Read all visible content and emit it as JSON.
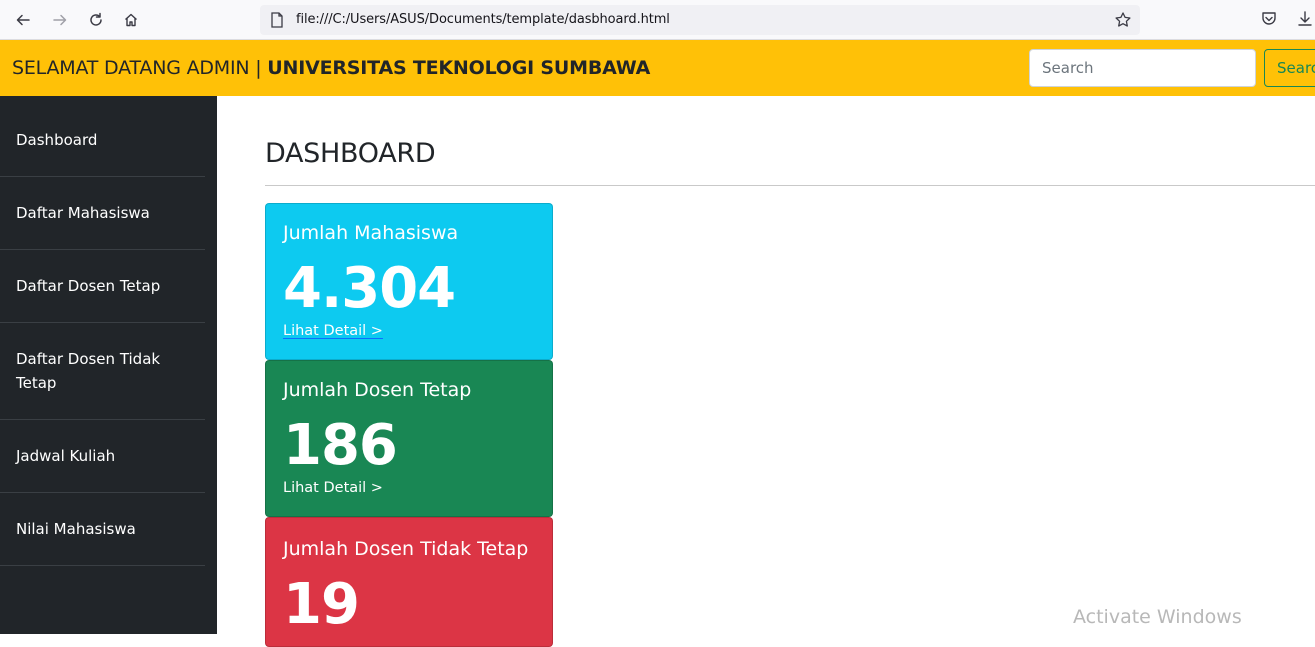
{
  "browser": {
    "url": "file:///C:/Users/ASUS/Documents/template/dasbhoard.html"
  },
  "navbar": {
    "brand_prefix": "SELAMAT DATANG ADMIN | ",
    "brand_bold": "UNIVERSITAS TEKNOLOGI SUMBAWA",
    "search_placeholder": "Search",
    "search_button": "Search",
    "background": "#ffc107"
  },
  "sidebar": {
    "items": [
      {
        "label": "Dashboard"
      },
      {
        "label": "Daftar Mahasiswa"
      },
      {
        "label": "Daftar Dosen Tetap"
      },
      {
        "label": "Daftar Dosen Tidak Tetap"
      },
      {
        "label": "Jadwal Kuliah"
      },
      {
        "label": "Nilai Mahasiswa"
      }
    ]
  },
  "main": {
    "title": "DASHBOARD",
    "cards": [
      {
        "title": "Jumlah Mahasiswa",
        "value": "4.304",
        "link": "Lihat Detail >",
        "color": "#0dcaf0"
      },
      {
        "title": "Jumlah Dosen Tetap",
        "value": "186",
        "link": "Lihat Detail >",
        "color": "#198754"
      },
      {
        "title": "Jumlah Dosen Tidak Tetap",
        "value": "19",
        "link": "",
        "color": "#dc3545"
      }
    ]
  },
  "watermark": "Activate Windows"
}
